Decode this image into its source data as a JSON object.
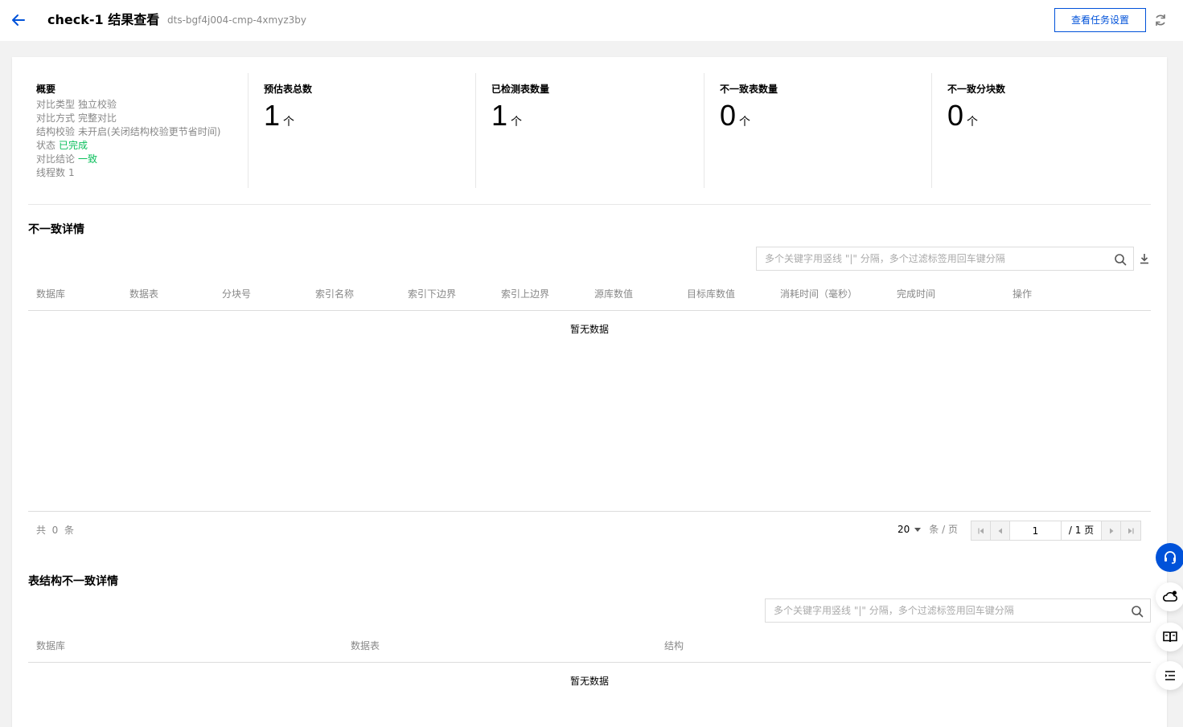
{
  "header": {
    "title": "check-1 结果查看",
    "task_id": "dts-bgf4j004-cmp-4xmyz3by",
    "settings_button": "查看任务设置"
  },
  "summary": {
    "heading": "概要",
    "rows": [
      {
        "label": "对比类型",
        "value": "独立校验",
        "status": "normal"
      },
      {
        "label": "对比方式",
        "value": "完整对比",
        "status": "normal"
      },
      {
        "label": "结构校验",
        "value": "未开启(关闭结构校验更节省时间)",
        "status": "normal"
      },
      {
        "label": "状态",
        "value": "已完成",
        "status": "success"
      },
      {
        "label": "对比结论",
        "value": "一致",
        "status": "success"
      },
      {
        "label": "线程数",
        "value": "1",
        "status": "normal"
      }
    ]
  },
  "stats": [
    {
      "label": "预估表总数",
      "value": "1",
      "unit": "个"
    },
    {
      "label": "已检测表数量",
      "value": "1",
      "unit": "个"
    },
    {
      "label": "不一致表数量",
      "value": "0",
      "unit": "个"
    },
    {
      "label": "不一致分块数",
      "value": "0",
      "unit": "个"
    }
  ],
  "inconsistency": {
    "title": "不一致详情",
    "search_placeholder": "多个关键字用竖线 \"|\" 分隔，多个过滤标签用回车键分隔",
    "columns": [
      "数据库",
      "数据表",
      "分块号",
      "索引名称",
      "索引下边界",
      "索引上边界",
      "源库数值",
      "目标库数值",
      "消耗时间（毫秒）",
      "完成时间",
      "操作"
    ],
    "empty_text": "暂无数据",
    "total_label": "共",
    "total_count": "0",
    "total_suffix": "条",
    "page_size": "20",
    "page_size_suffix": "条 / 页",
    "current_page": "1",
    "total_pages_label": "/ 1 页"
  },
  "structure": {
    "title": "表结构不一致详情",
    "search_placeholder": "多个关键字用竖线 \"|\" 分隔，多个过滤标签用回车键分隔",
    "columns": [
      "数据库",
      "数据表",
      "结构"
    ],
    "empty_text": "暂无数据"
  },
  "colors": {
    "primary": "#0052d9",
    "success": "#0abf5b",
    "muted": "#888888"
  }
}
